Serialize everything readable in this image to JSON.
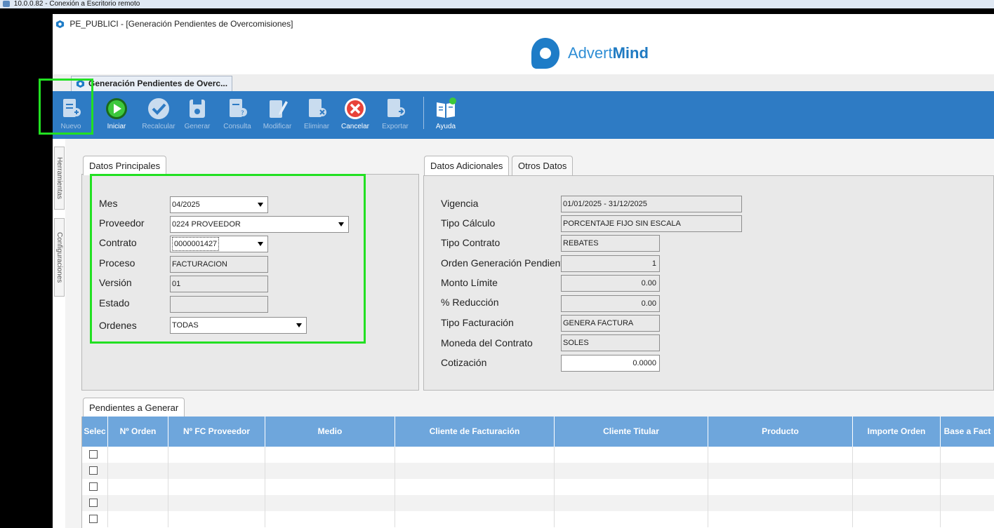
{
  "rdp": {
    "title": "10.0.0.82 - Conexión a Escritorio remoto"
  },
  "window": {
    "title": "PE_PUBLICI - [Generación Pendientes de Overcomisiones]"
  },
  "brand": {
    "name_light": "Advert",
    "name_bold": "Mind"
  },
  "doc_tab": {
    "label": "Generación Pendientes de Overc..."
  },
  "toolbar": {
    "nuevo": "Nuevo",
    "iniciar": "Iniciar",
    "recalcular": "Recalcular",
    "generar": "Generar",
    "consulta": "Consulta",
    "modificar": "Modificar",
    "eliminar": "Eliminar",
    "cancelar": "Cancelar",
    "exportar": "Exportar",
    "ayuda": "Ayuda"
  },
  "side_tabs": {
    "herramientas": "Herramientas",
    "configuraciones": "Configuraciones"
  },
  "datos_principales": {
    "tab": "Datos Principales",
    "mes_label": "Mes",
    "mes_value": "04/2025",
    "proveedor_label": "Proveedor",
    "proveedor_value": "0224 PROVEEDOR",
    "contrato_label": "Contrato",
    "contrato_value": "0000001427",
    "proceso_label": "Proceso",
    "proceso_value": "FACTURACION",
    "version_label": "Versión",
    "version_value": "01",
    "estado_label": "Estado",
    "estado_value": "",
    "ordenes_label": "Ordenes",
    "ordenes_value": "TODAS"
  },
  "datos_adicionales": {
    "tab": "Datos Adicionales",
    "tab2": "Otros Datos",
    "vigencia_label": "Vigencia",
    "vigencia_value": "01/01/2025 - 31/12/2025",
    "tipo_calculo_label": "Tipo Cálculo",
    "tipo_calculo_value": "PORCENTAJE FIJO SIN ESCALA",
    "tipo_contrato_label": "Tipo Contrato",
    "tipo_contrato_value": "REBATES",
    "orden_gen_label": "Orden Generación Pendiente",
    "orden_gen_value": "1",
    "monto_limite_label": "Monto Límite",
    "monto_limite_value": "0.00",
    "reduccion_label": "% Reducción",
    "reduccion_value": "0.00",
    "tipo_facturacion_label": "Tipo Facturación",
    "tipo_facturacion_value": "GENERA FACTURA",
    "moneda_label": "Moneda del Contrato",
    "moneda_value": "SOLES",
    "cotizacion_label": "Cotización",
    "cotizacion_value": "0.0000"
  },
  "pendientes": {
    "tab": "Pendientes a Generar",
    "columns": [
      "Selec",
      "Nº Orden",
      "Nº FC Proveedor",
      "Medio",
      "Cliente de Facturación",
      "Cliente Titular",
      "Producto",
      "Importe Orden",
      "Base a Fact"
    ]
  },
  "colors": {
    "ribbon": "#2e7bc4",
    "grid_header": "#6ea6dc",
    "highlight": "#22e022"
  },
  "icons": [
    "logo-icon",
    "new-doc-icon",
    "play-icon",
    "check-icon",
    "save-icon",
    "query-icon",
    "edit-icon",
    "delete-doc-icon",
    "cancel-icon",
    "export-icon",
    "help-book-icon",
    "dropdown-arrow-icon",
    "checkbox-icon"
  ]
}
